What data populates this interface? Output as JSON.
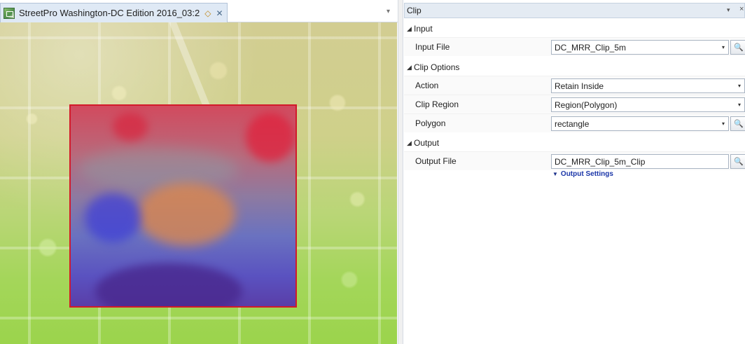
{
  "map_tab": {
    "title": "StreetPro Washington-DC Edition 2016_03:2",
    "pin_glyph": "◇",
    "close_glyph": "✕",
    "icon": "map-document-icon"
  },
  "tab_overflow_glyph": "▾",
  "tool": {
    "title": "Clip",
    "menu_glyph": "▾",
    "close_glyph": "×",
    "groups": {
      "input": {
        "label": "Input",
        "arrow": "◢"
      },
      "clip_options": {
        "label": "Clip Options",
        "arrow": "◢"
      },
      "output": {
        "label": "Output",
        "arrow": "◢"
      }
    },
    "fields": {
      "input_file": {
        "label": "Input File",
        "value": "DC_MRR_Clip_5m"
      },
      "action": {
        "label": "Action",
        "value": "Retain Inside"
      },
      "clip_region": {
        "label": "Clip Region",
        "value": "Region(Polygon)"
      },
      "polygon": {
        "label": "Polygon",
        "value": "rectangle"
      },
      "output_file": {
        "label": "Output File",
        "value": "DC_MRR_Clip_5m_Clip"
      }
    },
    "output_settings": {
      "label": "Output Settings",
      "arrow": "▼"
    },
    "dropdown_caret": "▾",
    "browse_glyph": "🔍"
  },
  "colors": {
    "clip_border": "#d21a2a",
    "header_bg": "#e4ebf3",
    "link": "#1a35a8"
  }
}
